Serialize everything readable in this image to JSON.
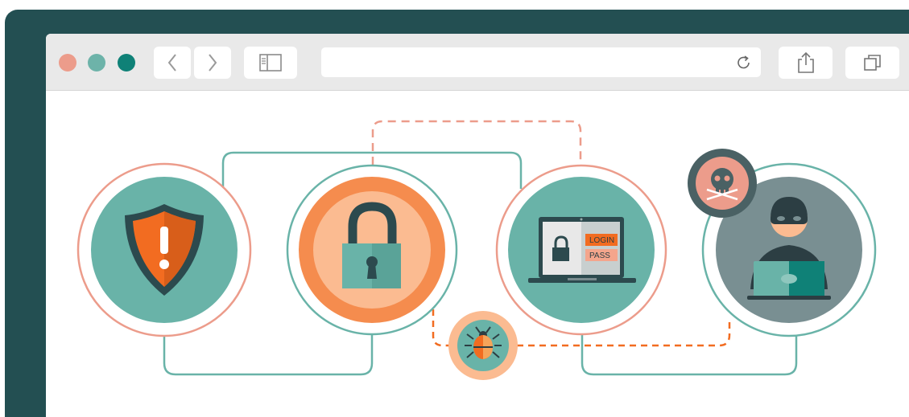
{
  "browser": {
    "window_dots": [
      "close",
      "minimize",
      "maximize"
    ],
    "dot_colors": [
      "#ec9c8b",
      "#6db3a9",
      "#0f8177"
    ],
    "address_bar": {
      "value": ""
    },
    "icons": {
      "back": "chevron-left-icon",
      "forward": "chevron-right-icon",
      "sidebar": "sidebar-icon",
      "reload": "reload-icon",
      "share": "share-icon",
      "tabs": "tabs-icon"
    }
  },
  "illustration": {
    "laptop_screen": {
      "login_label": "LOGIN",
      "pass_label": "PASS"
    },
    "colors": {
      "teal": "#69b3a8",
      "dark_teal": "#0f8177",
      "orange": "#f26c21",
      "salmon": "#ec9c8b",
      "peach": "#fbbb91",
      "slate": "#798f92",
      "dark": "#2c3e43"
    }
  }
}
